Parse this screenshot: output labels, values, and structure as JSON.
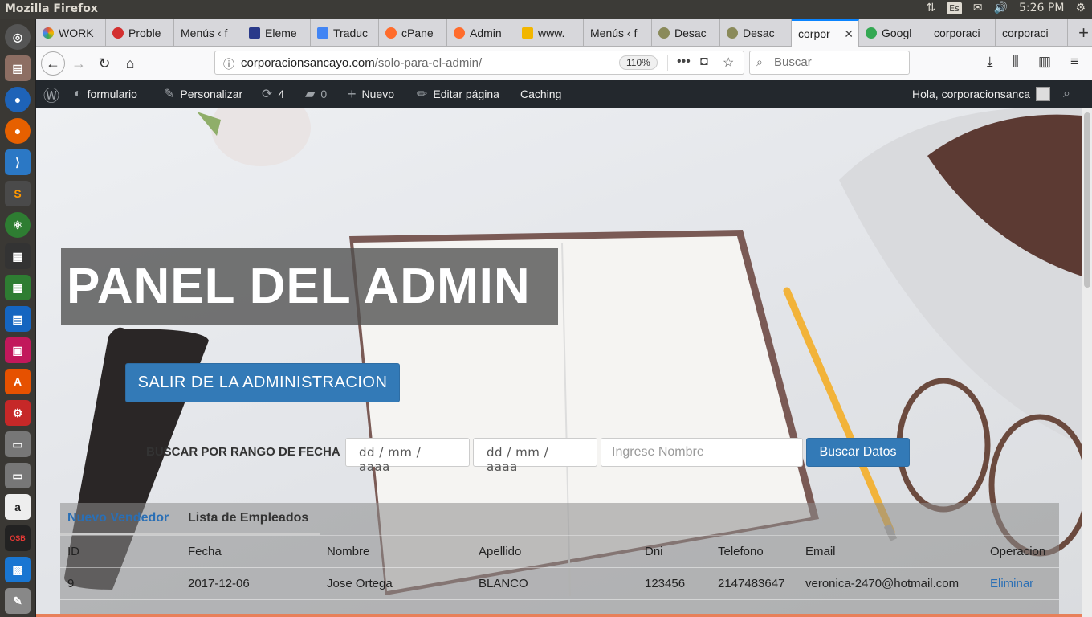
{
  "os": {
    "window_title": "Mozilla Firefox",
    "keyboard_layout": "Es",
    "clock": "5:26 PM"
  },
  "browser": {
    "tabs": [
      {
        "label": "WORK",
        "favicon_color": "#e0553c"
      },
      {
        "label": "Proble",
        "favicon_color": "#d32f2f"
      },
      {
        "label": "Menús ‹ f",
        "favicon_color": ""
      },
      {
        "label": "Eleme",
        "favicon_color": "#2a3a8a"
      },
      {
        "label": "Traduc",
        "favicon_color": "#4285f4"
      },
      {
        "label": "cPane",
        "favicon_color": "#ff6c2c"
      },
      {
        "label": "Admin",
        "favicon_color": "#ff6c2c"
      },
      {
        "label": "www.",
        "favicon_color": "#f2b600"
      },
      {
        "label": "Menús ‹ f",
        "favicon_color": ""
      },
      {
        "label": "Desac",
        "favicon_color": "#8a8a5a"
      },
      {
        "label": "Desac",
        "favicon_color": "#8a8a5a"
      },
      {
        "label": "corpor",
        "favicon_color": "",
        "active": true
      },
      {
        "label": "Googl",
        "favicon_color": "#34a853"
      },
      {
        "label": "corporaci",
        "favicon_color": ""
      },
      {
        "label": "corporaci",
        "favicon_color": ""
      }
    ],
    "url_domain": "corporacionsancayo.com",
    "url_path": "/solo-para-el-admin/",
    "zoom": "110%",
    "search_placeholder": "Buscar",
    "accent_color": "#0a84ff"
  },
  "wp_admin_bar": {
    "site_name": "formulario",
    "customize": "Personalizar",
    "updates_count": "4",
    "comments_count": "0",
    "new": "Nuevo",
    "edit_page": "Editar página",
    "caching": "Caching",
    "greeting": "Hola, corporacionsanca"
  },
  "page": {
    "title": "PANEL DEL ADMIN",
    "logout_button": "SALIR DE LA ADMINISTRACION",
    "range_label": "BUSCAR POR RANGO DE FECHA",
    "date_from_placeholder": "dd / mm / aaaa",
    "date_to_placeholder": "dd / mm / aaaa",
    "name_placeholder": "Ingrese Nombre",
    "search_button": "Buscar Datos",
    "primary_color": "#337ab7",
    "tabs": {
      "new_seller": "Nuevo Vendedor",
      "employee_list": "Lista de Empleados"
    },
    "table": {
      "headers": [
        "ID",
        "Fecha",
        "Nombre",
        "Apellido",
        "Dni",
        "Telefono",
        "Email",
        "Operacion"
      ],
      "rows": [
        [
          "9",
          "2017-12-06",
          "Jose Ortega",
          "BLANCO",
          "123456",
          "2147483647",
          "veronica-2470@hotmail.com",
          "Eliminar"
        ]
      ]
    }
  }
}
